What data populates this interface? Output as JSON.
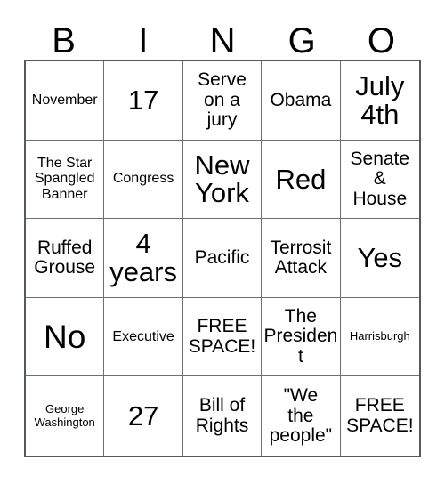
{
  "card": {
    "title": "BINGO",
    "header_letters": [
      "B",
      "I",
      "N",
      "G",
      "O"
    ],
    "columns": 5,
    "rows": 5,
    "text_color": "#000000",
    "background_color": "#ffffff",
    "border_color": "#555a5e",
    "grid_line_color": "#6b7073",
    "cells": [
      {
        "text": "November",
        "size": "sm"
      },
      {
        "text": "17",
        "size": "xl"
      },
      {
        "text": "Serve\non a\njury",
        "size": "md"
      },
      {
        "text": "Obama",
        "size": "md"
      },
      {
        "text": "July\n4th",
        "size": "xl"
      },
      {
        "text": "The Star\nSpangled\nBanner",
        "size": "sm"
      },
      {
        "text": "Congress",
        "size": "sm"
      },
      {
        "text": "New\nYork",
        "size": "xl"
      },
      {
        "text": "Red",
        "size": "xl"
      },
      {
        "text": "Senate\n&\nHouse",
        "size": "md"
      },
      {
        "text": "Ruffed\nGrouse",
        "size": "md"
      },
      {
        "text": "4\nyears",
        "size": "xl"
      },
      {
        "text": "Pacific",
        "size": "md"
      },
      {
        "text": "Terrosit\nAttack",
        "size": "md"
      },
      {
        "text": "Yes",
        "size": "xl"
      },
      {
        "text": "No",
        "size": "xxl"
      },
      {
        "text": "Executive",
        "size": "sm"
      },
      {
        "text": "FREE\nSPACE!",
        "size": "md"
      },
      {
        "text": "The\nPresident",
        "size": "md"
      },
      {
        "text": "Harrisburgh",
        "size": "xs"
      },
      {
        "text": "George\nWashington",
        "size": "xs"
      },
      {
        "text": "27",
        "size": "xl"
      },
      {
        "text": "Bill of\nRights",
        "size": "md"
      },
      {
        "text": "\"We\nthe\npeople\"",
        "size": "md"
      },
      {
        "text": "FREE\nSPACE!",
        "size": "md"
      }
    ]
  }
}
